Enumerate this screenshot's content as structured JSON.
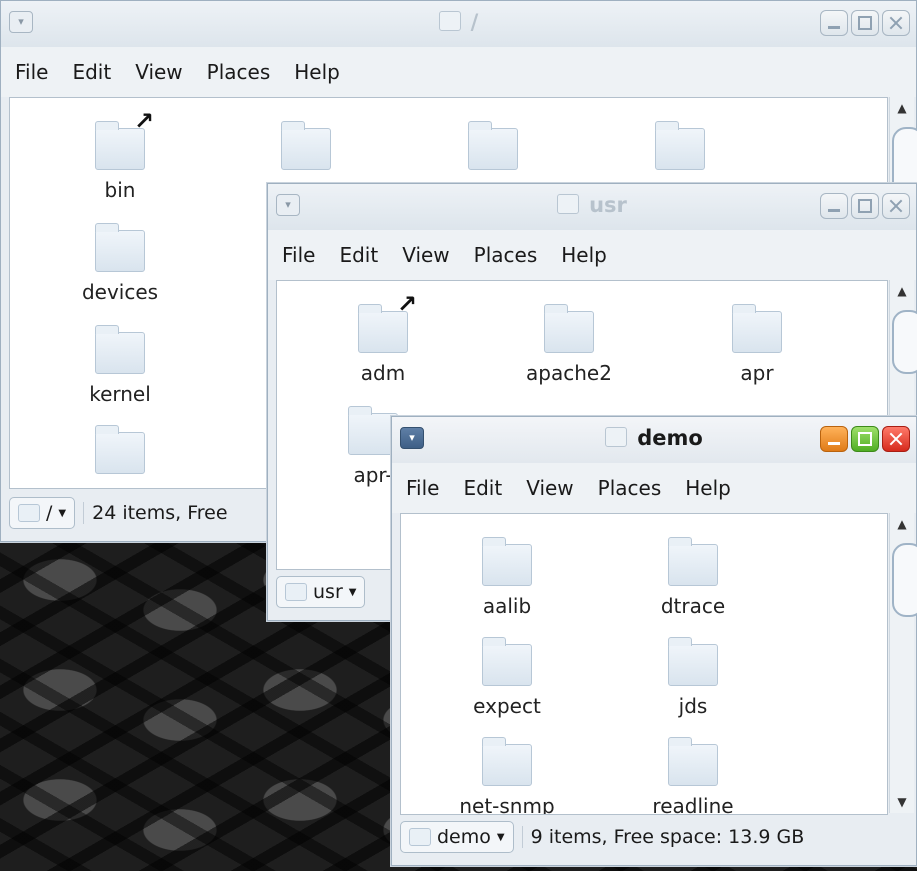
{
  "menus": [
    "File",
    "Edit",
    "View",
    "Places",
    "Help"
  ],
  "root": {
    "title": "/",
    "items": [
      "bin",
      "devices",
      "kernel"
    ],
    "path_label": "/",
    "status": "24 items, Free"
  },
  "usr": {
    "title": "usr",
    "items": [
      "adm",
      "apache2",
      "apr",
      "apr-"
    ],
    "path_label": "usr"
  },
  "demo": {
    "title": "demo",
    "items": [
      "aalib",
      "dtrace",
      "expect",
      "jds",
      "net-snmp",
      "readline"
    ],
    "path_label": "demo",
    "status": "9 items, Free space: 13.9 GB"
  },
  "colors": {
    "min_active": "#e07b17",
    "max_active": "#4fae24",
    "close_active": "#d62a1c",
    "inactive_title": "#b7c2cc"
  }
}
